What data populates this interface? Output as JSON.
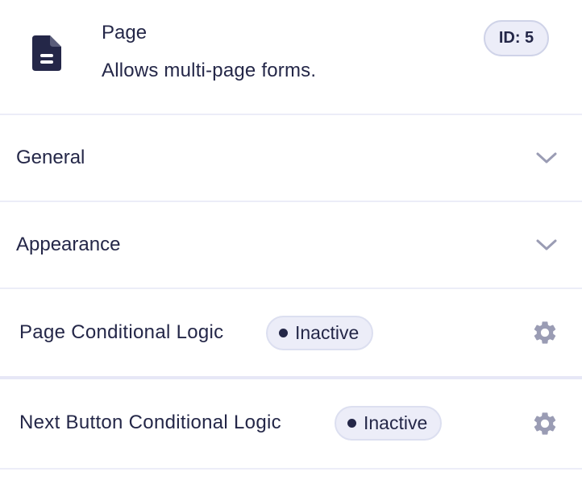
{
  "field": {
    "title": "Page",
    "description": "Allows multi-page forms.",
    "id_label": "ID: 5",
    "icon": "document-icon"
  },
  "sections": [
    {
      "label": "General",
      "icon": "chevron-down-icon"
    },
    {
      "label": "Appearance",
      "icon": "chevron-down-icon"
    }
  ],
  "logic": [
    {
      "label": "Page Conditional Logic",
      "status": "Inactive",
      "icon": "gear-icon"
    },
    {
      "label": "Next Button Conditional Logic",
      "status": "Inactive",
      "icon": "gear-icon"
    }
  ],
  "colors": {
    "text": "#242748",
    "icon_muted": "#9a9cb4",
    "badge_bg": "#ecedf8",
    "divider": "#ecedf8"
  }
}
